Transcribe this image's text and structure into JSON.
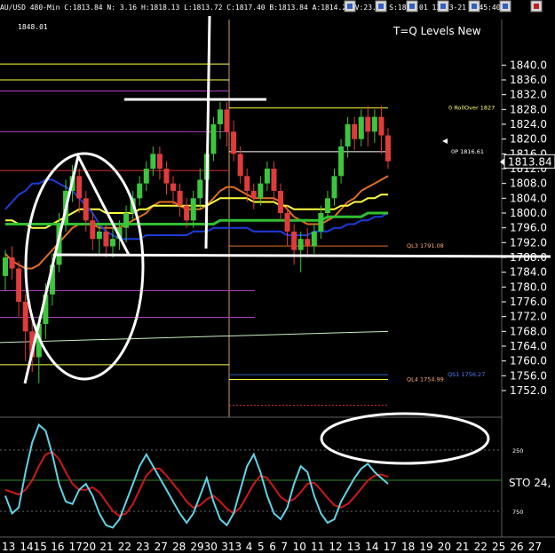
{
  "header": {
    "text": "AU/USD 480-Min C:1813.84 N: 3.16 H:1818.13 L:1813.72 C:1817.40 B:1813.84 A:1814.27 V:23.0K S:1848.01 12-13-21 5:45:40",
    "sub": "1848.01"
  },
  "toolbar_icons": [
    "arrow-icon",
    "zoom-icon",
    "chart-icon",
    "settings-icon",
    "print-icon",
    "refresh-icon",
    "close-icon"
  ],
  "title": "T=Q Levels New",
  "colors": {
    "bg": "#000000",
    "up": "#3cc63c",
    "down": "#e23b3b",
    "axis_text": "#ffffff",
    "blue_ma": "#1c3cdc",
    "green_ma": "#30c030",
    "orange_ma": "#e07020",
    "yellow_line": "#ffff40",
    "osc_cyan": "#5fd3e6",
    "osc_red": "#d01818",
    "annotation": "#ffffff"
  },
  "chart_data": {
    "type": "candlestick",
    "title": "T=Q Levels New",
    "ylim": [
      1746,
      1848
    ],
    "y_ticks": [
      1840,
      1836,
      1832,
      1828,
      1824,
      1820,
      1816,
      1812,
      1808,
      1804,
      1800,
      1796,
      1792,
      1788,
      1784,
      1780,
      1776,
      1772,
      1768,
      1764,
      1760,
      1756,
      1752
    ],
    "x_ticks": [
      "13",
      "1415",
      "16",
      "1720",
      "21",
      "22",
      "23",
      "27",
      "28",
      "2930",
      "313",
      "4",
      "5",
      "6",
      "7",
      "10",
      "11",
      "12",
      "13",
      "14",
      "17",
      "18",
      "19",
      "20",
      "21",
      "22",
      "25",
      "26",
      "27"
    ],
    "last_price": "1813.84",
    "candles": [
      [
        1783,
        1788,
        1779,
        1790
      ],
      [
        1788,
        1785,
        1782,
        1791
      ],
      [
        1785,
        1776,
        1772,
        1787
      ],
      [
        1776,
        1768,
        1760,
        1778
      ],
      [
        1768,
        1761,
        1757,
        1771
      ],
      [
        1761,
        1770,
        1754,
        1772
      ],
      [
        1770,
        1778,
        1766,
        1781
      ],
      [
        1778,
        1786,
        1775,
        1789
      ],
      [
        1786,
        1797,
        1784,
        1800
      ],
      [
        1797,
        1806,
        1795,
        1809
      ],
      [
        1806,
        1810,
        1803,
        1813
      ],
      [
        1810,
        1804,
        1800,
        1812
      ],
      [
        1804,
        1798,
        1795,
        1806
      ],
      [
        1798,
        1793,
        1790,
        1800
      ],
      [
        1793,
        1795,
        1789,
        1797
      ],
      [
        1795,
        1791,
        1788,
        1797
      ],
      [
        1791,
        1793,
        1788,
        1796
      ],
      [
        1793,
        1796,
        1790,
        1798
      ],
      [
        1796,
        1800,
        1792,
        1802
      ],
      [
        1800,
        1804,
        1798,
        1806
      ],
      [
        1804,
        1808,
        1802,
        1810
      ],
      [
        1808,
        1812,
        1806,
        1814
      ],
      [
        1812,
        1816,
        1810,
        1818
      ],
      [
        1816,
        1812,
        1809,
        1818
      ],
      [
        1812,
        1808,
        1805,
        1814
      ],
      [
        1808,
        1806,
        1802,
        1810
      ],
      [
        1806,
        1802,
        1799,
        1808
      ],
      [
        1802,
        1798,
        1796,
        1804
      ],
      [
        1798,
        1804,
        1796,
        1806
      ],
      [
        1804,
        1809,
        1801,
        1812
      ],
      [
        1809,
        1816,
        1806,
        1819
      ],
      [
        1816,
        1824,
        1814,
        1826
      ],
      [
        1824,
        1828,
        1820,
        1830
      ],
      [
        1828,
        1822,
        1818,
        1830
      ],
      [
        1822,
        1816,
        1814,
        1825
      ],
      [
        1816,
        1810,
        1808,
        1818
      ],
      [
        1810,
        1806,
        1803,
        1812
      ],
      [
        1806,
        1804,
        1801,
        1808
      ],
      [
        1804,
        1808,
        1802,
        1810
      ],
      [
        1808,
        1812,
        1806,
        1814
      ],
      [
        1812,
        1806,
        1803,
        1814
      ],
      [
        1806,
        1800,
        1798,
        1808
      ],
      [
        1800,
        1795,
        1791,
        1802
      ],
      [
        1795,
        1790,
        1786,
        1797
      ],
      [
        1790,
        1793,
        1784,
        1795
      ],
      [
        1793,
        1791,
        1788,
        1796
      ],
      [
        1791,
        1795,
        1789,
        1797
      ],
      [
        1795,
        1800,
        1793,
        1802
      ],
      [
        1800,
        1804,
        1798,
        1806
      ],
      [
        1804,
        1810,
        1802,
        1812
      ],
      [
        1810,
        1818,
        1808,
        1820
      ],
      [
        1818,
        1824,
        1815,
        1826
      ],
      [
        1824,
        1820,
        1817,
        1826
      ],
      [
        1820,
        1826,
        1818,
        1828
      ],
      [
        1826,
        1822,
        1818,
        1829
      ],
      [
        1822,
        1826,
        1819,
        1828
      ],
      [
        1826,
        1821,
        1816,
        1829
      ],
      [
        1821,
        1814,
        1812,
        1823
      ]
    ],
    "series": [
      {
        "values": [
          1789,
          1787,
          1786,
          1785,
          1785,
          1786,
          1788,
          1790,
          1792,
          1794,
          1796,
          1797,
          1797,
          1797,
          1796,
          1796,
          1796,
          1796,
          1797,
          1798,
          1799,
          1800,
          1802,
          1803,
          1803,
          1803,
          1802,
          1801,
          1801,
          1801,
          1802,
          1804,
          1806,
          1807,
          1807,
          1806,
          1805,
          1804,
          1804,
          1804,
          1804,
          1803,
          1801,
          1799,
          1798,
          1797,
          1797,
          1797,
          1798,
          1799,
          1801,
          1803,
          1804,
          1806,
          1807,
          1808,
          1809,
          1810
        ]
      },
      {
        "values": [
          1798,
          1798,
          1797,
          1797,
          1796,
          1796,
          1796,
          1797,
          1798,
          1799,
          1800,
          1801,
          1801,
          1801,
          1801,
          1800,
          1800,
          1800,
          1800,
          1800,
          1801,
          1801,
          1802,
          1802,
          1802,
          1802,
          1802,
          1802,
          1802,
          1802,
          1802,
          1803,
          1804,
          1804,
          1804,
          1804,
          1804,
          1803,
          1803,
          1803,
          1803,
          1802,
          1802,
          1801,
          1801,
          1801,
          1801,
          1801,
          1801,
          1801,
          1802,
          1802,
          1803,
          1803,
          1804,
          1804,
          1805,
          1805
        ]
      },
      {
        "values": [
          1801,
          1803,
          1805,
          1806,
          1808,
          1808,
          1809,
          1809,
          1808,
          1807,
          1806,
          1804,
          1802,
          1800,
          1797,
          1795,
          1794,
          1793,
          1793,
          1793,
          1793,
          1794,
          1794,
          1794,
          1794,
          1794,
          1794,
          1794,
          1795,
          1795,
          1795,
          1796,
          1796,
          1796,
          1796,
          1796,
          1796,
          1795,
          1795,
          1795,
          1795,
          1795,
          1794,
          1794,
          1794,
          1794,
          1795,
          1795,
          1795,
          1796,
          1796,
          1797,
          1797,
          1798,
          1798,
          1799,
          1799,
          1800
        ]
      },
      {
        "values": [
          1797,
          1797,
          1797,
          1797,
          1797,
          1797,
          1797,
          1797,
          1797,
          1797,
          1797,
          1797,
          1797,
          1797,
          1797,
          1797,
          1797,
          1797,
          1797,
          1797,
          1797,
          1797,
          1797,
          1797,
          1797,
          1797,
          1797,
          1797,
          1797,
          1797,
          1797,
          1797,
          1798,
          1798,
          1798,
          1798,
          1798,
          1798,
          1798,
          1798,
          1798,
          1798,
          1798,
          1798,
          1798,
          1798,
          1798,
          1798,
          1799,
          1799,
          1799,
          1799,
          1799,
          1799,
          1800,
          1800,
          1800,
          1800
        ]
      }
    ],
    "oscillator": {
      "label": "STO 24,",
      "tick_labels": [
        "250",
        "750"
      ],
      "cyan": [
        35,
        20,
        25,
        55,
        80,
        95,
        90,
        70,
        45,
        30,
        28,
        40,
        45,
        35,
        20,
        10,
        8,
        15,
        30,
        45,
        60,
        70,
        60,
        50,
        40,
        30,
        20,
        12,
        20,
        35,
        50,
        30,
        15,
        10,
        20,
        40,
        60,
        70,
        55,
        35,
        20,
        15,
        25,
        45,
        60,
        55,
        35,
        20,
        12,
        15,
        30,
        40,
        50,
        58,
        62,
        55,
        50,
        45
      ],
      "red": [
        40,
        38,
        36,
        40,
        48,
        60,
        70,
        72,
        66,
        55,
        45,
        40,
        40,
        42,
        38,
        30,
        22,
        18,
        20,
        28,
        40,
        52,
        58,
        58,
        52,
        45,
        38,
        30,
        25,
        27,
        32,
        35,
        30,
        24,
        20,
        25,
        35,
        45,
        52,
        50,
        42,
        34,
        30,
        32,
        38,
        45,
        46,
        40,
        33,
        27,
        25,
        28,
        34,
        41,
        48,
        52,
        53,
        51
      ]
    },
    "levels": [
      {
        "label": "0 RollOver 1827",
        "value": 1828.4
      },
      {
        "label": "0P 1816.61",
        "value": 1816.6
      },
      {
        "label": "QL3 1791.08",
        "value": 1791.1
      },
      {
        "label": "QL4 1754.99",
        "value": 1755.0
      },
      {
        "label": "QS1 1756.27",
        "value": 1756.3
      }
    ]
  }
}
